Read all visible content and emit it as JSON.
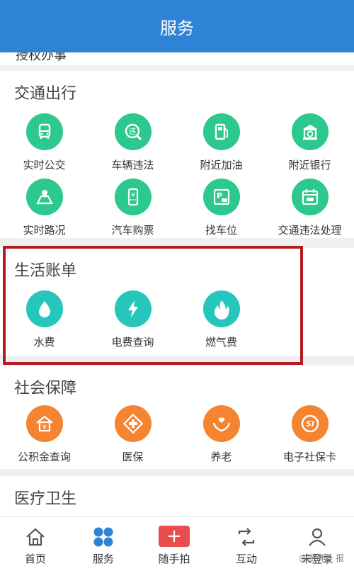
{
  "header": {
    "title": "服务"
  },
  "cut_row": {
    "text": "授权办事"
  },
  "sections": {
    "traffic": {
      "title": "交通出行",
      "items": [
        "实时公交",
        "车辆违法",
        "附近加油",
        "附近银行",
        "实时路况",
        "汽车购票",
        "找车位",
        "交通违法处理"
      ]
    },
    "bills": {
      "title": "生活账单",
      "items": [
        "水费",
        "电费查询",
        "燃气费"
      ]
    },
    "social": {
      "title": "社会保障",
      "items": [
        "公积金查询",
        "医保",
        "养老",
        "电子社保卡"
      ]
    },
    "medical": {
      "title": "医疗卫生"
    }
  },
  "icons": {
    "traffic": [
      "bus-icon",
      "violation-icon",
      "gas-station-icon",
      "bank-icon",
      "map-icon",
      "ticket-icon",
      "parking-icon",
      "calendar-car-icon"
    ],
    "bills": [
      "water-drop-icon",
      "lightning-icon",
      "flame-icon"
    ],
    "social": [
      "house-yuan-icon",
      "medical-box-icon",
      "hands-heart-icon",
      "si-card-icon"
    ]
  },
  "tabbar": {
    "tabs": [
      "首页",
      "服务",
      "随手拍",
      "互动",
      "未登录"
    ]
  },
  "watermark": "@澎湃号 报",
  "colors": {
    "header": "#2f83d6",
    "green": "#2cc88e",
    "teal": "#27c6bd",
    "orange": "#f58431",
    "highlight": "#b51c22",
    "plus": "#e84c4c"
  }
}
